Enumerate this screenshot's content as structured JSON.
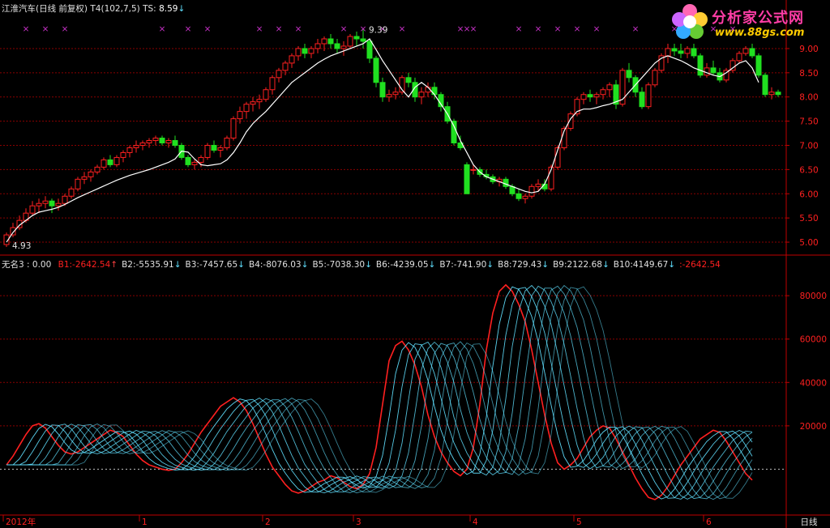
{
  "header": {
    "stock": "江淮汽车(日线 前复权)",
    "indicator": "T4(102,7,5)",
    "ts_label": "TS:",
    "ts_value": "8.59",
    "ts_arrow": "↓"
  },
  "sub_header": {
    "name": "无名3 : 0.00",
    "items": [
      {
        "label": "B1:",
        "value": "-2642.54",
        "arrow": "↑",
        "color": "#ff4040"
      },
      {
        "label": "B2:",
        "value": "-5535.91",
        "arrow": "↓",
        "color": "#60e0ff"
      },
      {
        "label": "B3:",
        "value": "-7457.65",
        "arrow": "↓",
        "color": "#60e0ff"
      },
      {
        "label": "B4:",
        "value": "-8076.03",
        "arrow": "↓",
        "color": "#60e0ff"
      },
      {
        "label": "B5:",
        "value": "-7038.30",
        "arrow": "↓",
        "color": "#60e0ff"
      },
      {
        "label": "B6:",
        "value": "-4239.05",
        "arrow": "↓",
        "color": "#60e0ff"
      },
      {
        "label": "B7:",
        "value": "-741.90",
        "arrow": "↓",
        "color": "#60e0ff"
      },
      {
        "label": "B8:",
        "value": "729.43",
        "arrow": "↓",
        "color": "#60e0ff"
      },
      {
        "label": "B9:",
        "value": "2122.68",
        "arrow": "↓",
        "color": "#60e0ff"
      },
      {
        "label": "B10:",
        "value": "4149.67",
        "arrow": "↓",
        "color": "#60e0ff"
      },
      {
        "label": ":",
        "value": "-2642.54",
        "arrow": "",
        "color": "#ff4040"
      }
    ]
  },
  "logo": {
    "text": "分析家公式网",
    "url": "www.88gs.com"
  },
  "colors": {
    "up": "#ff2020",
    "down": "#20e020",
    "grid": "#8a0000",
    "axis": "#c00000",
    "cyan": "#60e0ff",
    "white": "#ffffff",
    "mark": "#cc33cc"
  },
  "chart_data": [
    {
      "type": "candlestick",
      "title": "江淮汽车(日线 前复权)",
      "ylim": [
        4.85,
        9.2
      ],
      "y_ticks": [
        "5.00",
        "5.50",
        "6.00",
        "6.50",
        "7.00",
        "7.50",
        "8.00",
        "8.50",
        "9.00"
      ],
      "annotations": [
        {
          "text": "9.39",
          "x": 55,
          "y": 9.39
        },
        {
          "text": "4.93",
          "x": 0,
          "y": 4.93
        }
      ],
      "marker_symbol": "×",
      "markers_x": [
        3,
        6,
        9,
        24,
        28,
        31,
        39,
        42,
        45,
        52,
        55,
        58,
        61,
        70,
        71,
        72,
        79,
        82,
        85,
        88,
        91,
        97,
        103,
        109,
        112
      ],
      "ma": [
        5.0,
        5.2,
        5.35,
        5.45,
        5.55,
        5.62,
        5.65,
        5.68,
        5.72,
        5.78,
        5.85,
        5.92,
        5.98,
        6.04,
        6.1,
        6.16,
        6.22,
        6.28,
        6.33,
        6.38,
        6.42,
        6.46,
        6.5,
        6.55,
        6.6,
        6.65,
        6.72,
        6.88,
        6.86,
        6.72,
        6.6,
        6.58,
        6.6,
        6.62,
        6.7,
        6.85,
        7.05,
        7.28,
        7.45,
        7.58,
        7.7,
        7.85,
        8.0,
        8.15,
        8.3,
        8.4,
        8.5,
        8.6,
        8.7,
        8.78,
        8.85,
        8.9,
        8.95,
        9.0,
        9.05,
        9.1,
        9.2,
        8.98,
        8.75,
        8.55,
        8.35,
        8.15,
        8.0,
        8.2,
        8.3,
        8.2,
        8.05,
        7.85,
        7.65,
        7.4,
        7.1,
        6.85,
        6.6,
        6.45,
        6.35,
        6.3,
        6.25,
        6.2,
        6.15,
        6.1,
        6.05,
        6.02,
        6.05,
        6.2,
        6.5,
        6.9,
        7.3,
        7.55,
        7.7,
        7.75,
        7.75,
        7.78,
        7.82,
        7.85,
        7.9,
        7.95,
        8.1,
        8.25,
        8.4,
        8.55,
        8.7,
        8.8,
        8.85,
        8.8,
        8.75,
        8.68,
        8.6,
        8.55,
        8.5,
        8.45,
        8.42,
        8.5,
        8.6,
        8.7,
        8.75,
        8.6,
        8.3
      ],
      "ohlc": [
        [
          4.95,
          5.2,
          4.9,
          5.15
        ],
        [
          5.15,
          5.4,
          5.1,
          5.3
        ],
        [
          5.3,
          5.55,
          5.25,
          5.45
        ],
        [
          5.45,
          5.7,
          5.4,
          5.6
        ],
        [
          5.6,
          5.85,
          5.55,
          5.75
        ],
        [
          5.75,
          5.9,
          5.6,
          5.8
        ],
        [
          5.8,
          5.95,
          5.7,
          5.85
        ],
        [
          5.85,
          5.9,
          5.6,
          5.75
        ],
        [
          5.75,
          5.9,
          5.65,
          5.8
        ],
        [
          5.8,
          6.0,
          5.75,
          5.95
        ],
        [
          5.95,
          6.15,
          5.9,
          6.1
        ],
        [
          6.1,
          6.35,
          6.05,
          6.3
        ],
        [
          6.3,
          6.45,
          6.2,
          6.35
        ],
        [
          6.35,
          6.5,
          6.25,
          6.45
        ],
        [
          6.45,
          6.6,
          6.4,
          6.55
        ],
        [
          6.55,
          6.75,
          6.5,
          6.7
        ],
        [
          6.7,
          6.8,
          6.55,
          6.6
        ],
        [
          6.6,
          6.8,
          6.55,
          6.75
        ],
        [
          6.75,
          6.9,
          6.65,
          6.85
        ],
        [
          6.85,
          7.0,
          6.75,
          6.95
        ],
        [
          6.95,
          7.1,
          6.85,
          7.0
        ],
        [
          7.0,
          7.1,
          6.9,
          7.05
        ],
        [
          7.05,
          7.15,
          6.95,
          7.1
        ],
        [
          7.1,
          7.2,
          7.0,
          7.15
        ],
        [
          7.15,
          7.2,
          7.0,
          7.05
        ],
        [
          7.05,
          7.15,
          6.95,
          7.1
        ],
        [
          7.1,
          7.2,
          6.95,
          7.0
        ],
        [
          7.0,
          7.05,
          6.7,
          6.75
        ],
        [
          6.75,
          6.8,
          6.55,
          6.6
        ],
        [
          6.6,
          6.7,
          6.5,
          6.65
        ],
        [
          6.65,
          6.8,
          6.55,
          6.75
        ],
        [
          6.75,
          7.05,
          6.7,
          7.0
        ],
        [
          7.0,
          7.1,
          6.85,
          6.9
        ],
        [
          6.9,
          7.0,
          6.75,
          6.95
        ],
        [
          6.95,
          7.2,
          6.9,
          7.15
        ],
        [
          7.15,
          7.6,
          7.1,
          7.55
        ],
        [
          7.55,
          7.8,
          7.45,
          7.7
        ],
        [
          7.7,
          7.9,
          7.55,
          7.85
        ],
        [
          7.85,
          8.0,
          7.7,
          7.9
        ],
        [
          7.9,
          8.05,
          7.75,
          7.95
        ],
        [
          7.95,
          8.2,
          7.9,
          8.15
        ],
        [
          8.15,
          8.45,
          8.05,
          8.4
        ],
        [
          8.4,
          8.6,
          8.3,
          8.55
        ],
        [
          8.55,
          8.75,
          8.45,
          8.7
        ],
        [
          8.7,
          8.9,
          8.6,
          8.85
        ],
        [
          8.85,
          9.05,
          8.75,
          9.0
        ],
        [
          9.0,
          9.1,
          8.8,
          8.9
        ],
        [
          8.9,
          9.05,
          8.8,
          9.0
        ],
        [
          9.0,
          9.2,
          8.9,
          9.1
        ],
        [
          9.1,
          9.25,
          8.95,
          9.2
        ],
        [
          9.2,
          9.3,
          9.0,
          9.1
        ],
        [
          9.1,
          9.2,
          8.9,
          9.0
        ],
        [
          9.0,
          9.15,
          8.85,
          9.05
        ],
        [
          9.05,
          9.3,
          9.0,
          9.25
        ],
        [
          9.25,
          9.35,
          9.05,
          9.2
        ],
        [
          9.2,
          9.39,
          9.0,
          9.15
        ],
        [
          9.15,
          9.2,
          8.7,
          8.8
        ],
        [
          8.8,
          8.85,
          8.2,
          8.3
        ],
        [
          8.3,
          8.4,
          7.9,
          8.0
        ],
        [
          8.0,
          8.15,
          7.9,
          8.05
        ],
        [
          8.05,
          8.2,
          7.95,
          8.1
        ],
        [
          8.1,
          8.45,
          8.05,
          8.4
        ],
        [
          8.4,
          8.5,
          8.2,
          8.3
        ],
        [
          8.3,
          8.4,
          7.9,
          8.0
        ],
        [
          8.0,
          8.2,
          7.85,
          8.1
        ],
        [
          8.1,
          8.3,
          8.0,
          8.2
        ],
        [
          8.2,
          8.3,
          7.95,
          8.05
        ],
        [
          8.05,
          8.1,
          7.7,
          7.8
        ],
        [
          7.8,
          7.9,
          7.45,
          7.5
        ],
        [
          7.5,
          7.55,
          7.0,
          7.05
        ],
        [
          7.05,
          7.2,
          6.9,
          6.95
        ],
        [
          6.6,
          6.65,
          6.0,
          6.0
        ],
        [
          6.5,
          6.6,
          6.4,
          6.5
        ],
        [
          6.5,
          6.55,
          6.35,
          6.4
        ],
        [
          6.4,
          6.5,
          6.3,
          6.35
        ],
        [
          6.35,
          6.4,
          6.2,
          6.25
        ],
        [
          6.25,
          6.35,
          6.15,
          6.3
        ],
        [
          6.3,
          6.35,
          6.1,
          6.15
        ],
        [
          6.15,
          6.2,
          5.95,
          6.0
        ],
        [
          6.0,
          6.1,
          5.85,
          5.9
        ],
        [
          5.9,
          6.0,
          5.8,
          5.95
        ],
        [
          5.95,
          6.2,
          5.9,
          6.15
        ],
        [
          6.15,
          6.3,
          6.05,
          6.2
        ],
        [
          6.2,
          6.3,
          6.05,
          6.1
        ],
        [
          6.1,
          6.6,
          6.05,
          6.55
        ],
        [
          6.55,
          7.0,
          6.5,
          6.95
        ],
        [
          6.95,
          7.4,
          6.9,
          7.35
        ],
        [
          7.35,
          7.7,
          7.3,
          7.65
        ],
        [
          7.65,
          8.0,
          7.6,
          7.95
        ],
        [
          7.95,
          8.1,
          7.85,
          8.05
        ],
        [
          8.05,
          8.15,
          7.9,
          8.0
        ],
        [
          8.0,
          8.1,
          7.85,
          8.05
        ],
        [
          8.05,
          8.2,
          7.95,
          8.15
        ],
        [
          8.15,
          8.3,
          8.0,
          8.25
        ],
        [
          8.25,
          8.35,
          7.75,
          7.85
        ],
        [
          7.85,
          8.6,
          7.8,
          8.55
        ],
        [
          8.55,
          8.7,
          8.3,
          8.4
        ],
        [
          8.4,
          8.45,
          8.0,
          8.1
        ],
        [
          8.1,
          8.2,
          7.75,
          7.8
        ],
        [
          7.8,
          8.3,
          7.75,
          8.25
        ],
        [
          8.25,
          8.6,
          8.2,
          8.55
        ],
        [
          8.55,
          8.9,
          8.5,
          8.85
        ],
        [
          8.85,
          9.1,
          8.7,
          9.0
        ],
        [
          9.0,
          9.1,
          8.85,
          8.95
        ],
        [
          8.95,
          9.1,
          8.8,
          8.9
        ],
        [
          8.9,
          9.05,
          8.8,
          9.0
        ],
        [
          9.0,
          9.1,
          8.8,
          8.85
        ],
        [
          8.85,
          8.9,
          8.4,
          8.45
        ],
        [
          8.45,
          8.7,
          8.4,
          8.6
        ],
        [
          8.6,
          8.75,
          8.45,
          8.5
        ],
        [
          8.5,
          8.6,
          8.3,
          8.35
        ],
        [
          8.35,
          8.6,
          8.3,
          8.55
        ],
        [
          8.55,
          8.8,
          8.5,
          8.75
        ],
        [
          8.75,
          8.95,
          8.7,
          8.9
        ],
        [
          8.9,
          9.05,
          8.85,
          9.0
        ],
        [
          9.0,
          9.1,
          8.8,
          8.85
        ],
        [
          8.85,
          8.9,
          8.4,
          8.45
        ],
        [
          8.45,
          8.5,
          8.0,
          8.05
        ],
        [
          8.05,
          8.2,
          7.95,
          8.1
        ],
        [
          8.1,
          8.15,
          8.0,
          8.05
        ]
      ]
    },
    {
      "type": "line",
      "title": "无名3",
      "ylim": [
        -20000,
        92000
      ],
      "y_ticks": [
        "20000",
        "40000",
        "60000",
        "80000"
      ],
      "x_tick_labels": [
        {
          "label": "2012年",
          "i": 0
        },
        {
          "label": "1",
          "i": 21
        },
        {
          "label": "2",
          "i": 40
        },
        {
          "label": "3",
          "i": 54
        },
        {
          "label": "4",
          "i": 72
        },
        {
          "label": "5",
          "i": 88
        },
        {
          "label": "6",
          "i": 108
        }
      ],
      "right_label": "日线",
      "base_series": [
        2000,
        6000,
        11000,
        16000,
        20000,
        21000,
        19000,
        15000,
        11000,
        8000,
        7000,
        8000,
        10000,
        12000,
        14000,
        16000,
        18000,
        17000,
        15000,
        11000,
        7000,
        4000,
        2000,
        1000,
        0,
        -500,
        0,
        3000,
        7000,
        12000,
        17000,
        21000,
        25000,
        29000,
        31000,
        33000,
        31000,
        27000,
        21000,
        14000,
        7000,
        1000,
        -3000,
        -7000,
        -10000,
        -11000,
        -10000,
        -8000,
        -6000,
        -5000,
        -3000,
        -4000,
        -6000,
        -8000,
        -9000,
        -7000,
        -2000,
        10000,
        30000,
        50000,
        57000,
        59000,
        55000,
        48000,
        38000,
        25000,
        15000,
        8000,
        3000,
        -1000,
        -3000,
        0,
        10000,
        30000,
        55000,
        72000,
        82000,
        85000,
        82000,
        76000,
        68000,
        55000,
        40000,
        25000,
        12000,
        3000,
        0,
        2000,
        5000,
        10000,
        15000,
        18000,
        20000,
        19000,
        14000,
        8000,
        2000,
        -4000,
        -9000,
        -13000,
        -14000,
        -12000,
        -8000,
        -3000,
        2000,
        6000,
        10000,
        14000,
        16000,
        18000,
        17000,
        13000,
        8000,
        3000,
        -2000,
        -5000
      ],
      "series_names": [
        "B1",
        "B2",
        "B3",
        "B4",
        "B5",
        "B6",
        "B7",
        "B8",
        "B9",
        "B10"
      ]
    }
  ]
}
